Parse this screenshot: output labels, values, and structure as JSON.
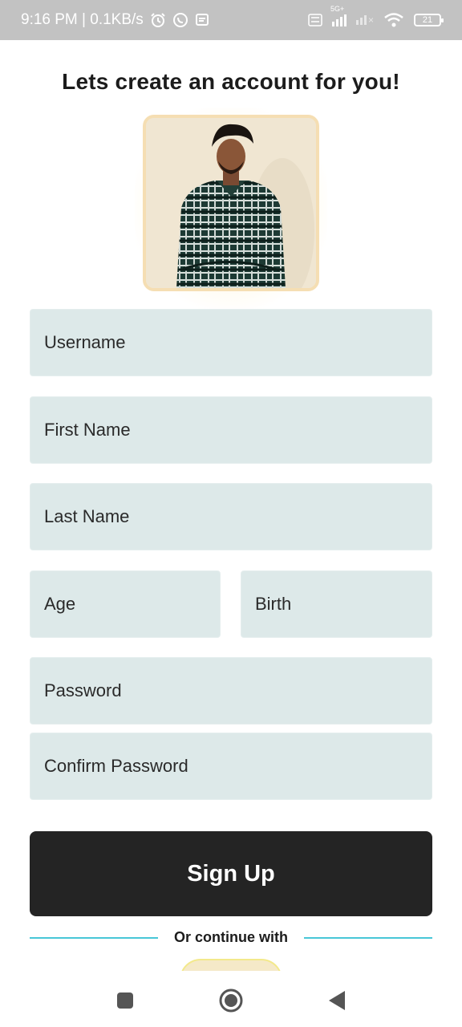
{
  "status_bar": {
    "time_speed": "9:16 PM | 0.1KB/s",
    "network": "5G+",
    "battery": "21",
    "icons": [
      "alarm-icon",
      "whatsapp-icon",
      "message-icon",
      "volte-icon",
      "signal-icon",
      "signal-off-icon",
      "wifi-icon",
      "battery-icon"
    ]
  },
  "header": {
    "title": "Lets create an account for you!"
  },
  "form": {
    "username_placeholder": "Username",
    "first_name_placeholder": "First Name",
    "last_name_placeholder": "Last Name",
    "age_placeholder": "Age",
    "birth_placeholder": "Birth",
    "password_placeholder": "Password",
    "confirm_password_placeholder": "Confirm Password"
  },
  "actions": {
    "signup_label": "Sign Up",
    "continue_with_label": "Or continue with"
  },
  "nav_bar": {
    "icons": [
      "recent-apps-icon",
      "home-icon",
      "back-icon"
    ]
  },
  "colors": {
    "field_bg": "#dde9e9",
    "button_bg": "#242424",
    "divider": "#48c7d7",
    "status_bar_bg": "#c2c2c2"
  }
}
